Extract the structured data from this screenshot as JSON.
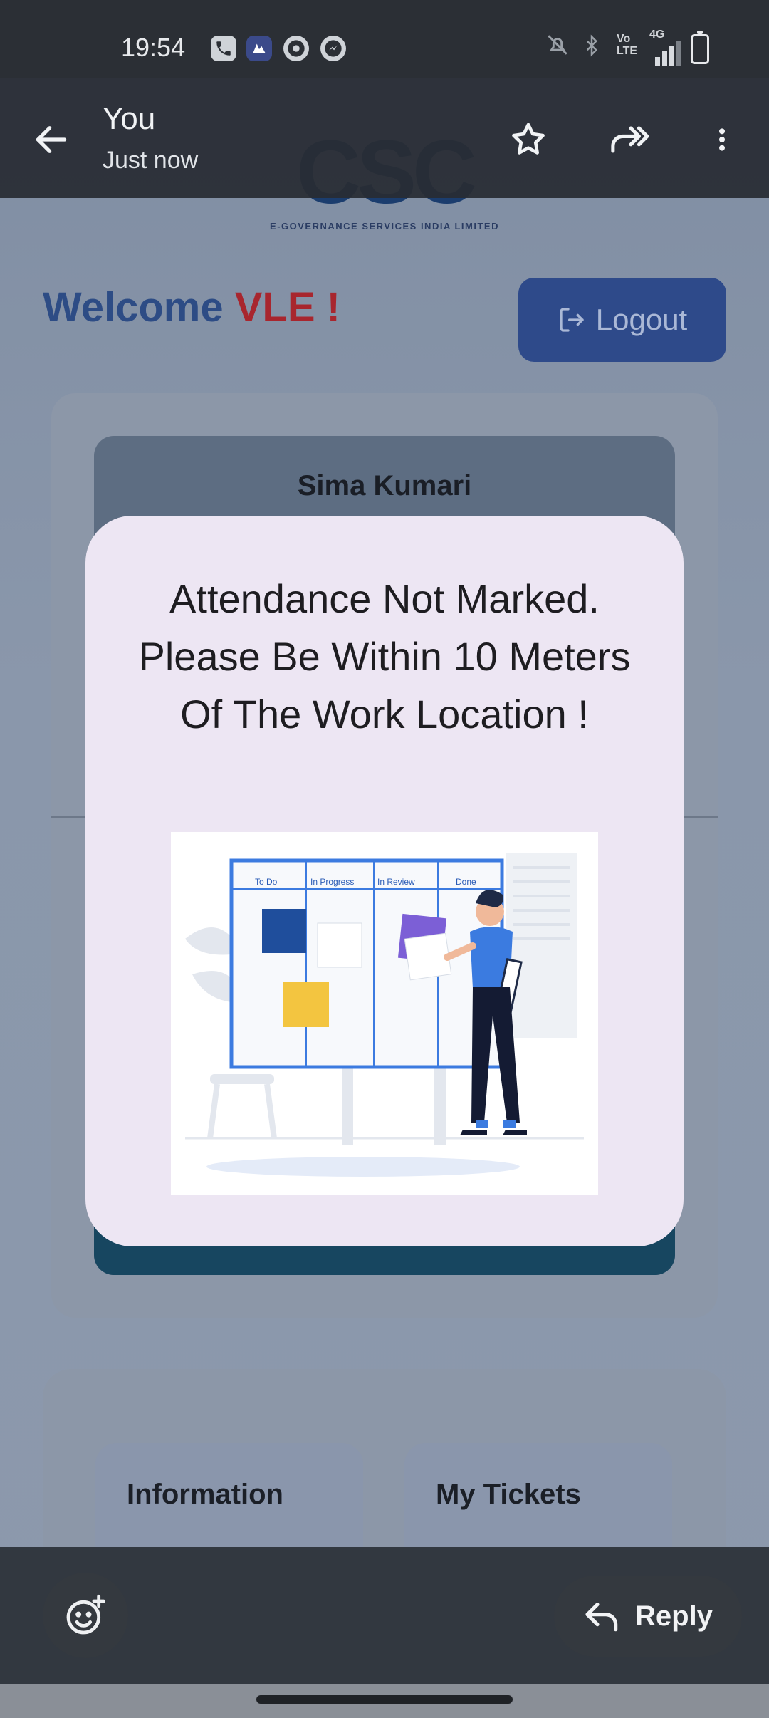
{
  "status_bar": {
    "time": "19:54",
    "left_icons": [
      "phone-call-icon",
      "app-icon",
      "chrome-icon",
      "messenger-icon"
    ],
    "right_icons": [
      "mute-icon",
      "bluetooth-icon",
      "volte-icon",
      "signal-4g-icon",
      "battery-icon"
    ],
    "volte_text": "Vo LTE",
    "network_text": "4G"
  },
  "viewer_header": {
    "sender": "You",
    "timestamp": "Just now",
    "actions": [
      "back-arrow-icon",
      "star-icon",
      "forward-icon",
      "more-vertical-icon"
    ]
  },
  "background_app": {
    "logo_text": "CSC",
    "logo_tagline": "e-Governance Services India Limited",
    "welcome_prefix": "Welcome",
    "welcome_highlight": "VLE !",
    "logout_label": "Logout",
    "profile_name": "Sima Kumari",
    "tiles": [
      {
        "label": "Information"
      },
      {
        "label": "My Tickets"
      }
    ]
  },
  "dialog": {
    "message": "Attendance Not Marked. Please Be Within 10 Meters Of The Work Location !",
    "illustration": {
      "columns": [
        "To Do",
        "In Progress",
        "In Review",
        "Done"
      ]
    }
  },
  "action_bar": {
    "emoji_icon": "add-reaction-icon",
    "reply_label": "Reply"
  },
  "colors": {
    "logo": "#1b3d6e",
    "welcome": "#2d4c85",
    "highlight": "#a8262e",
    "dialog_bg": "#ede6f3",
    "header_bg": "#282d34"
  }
}
